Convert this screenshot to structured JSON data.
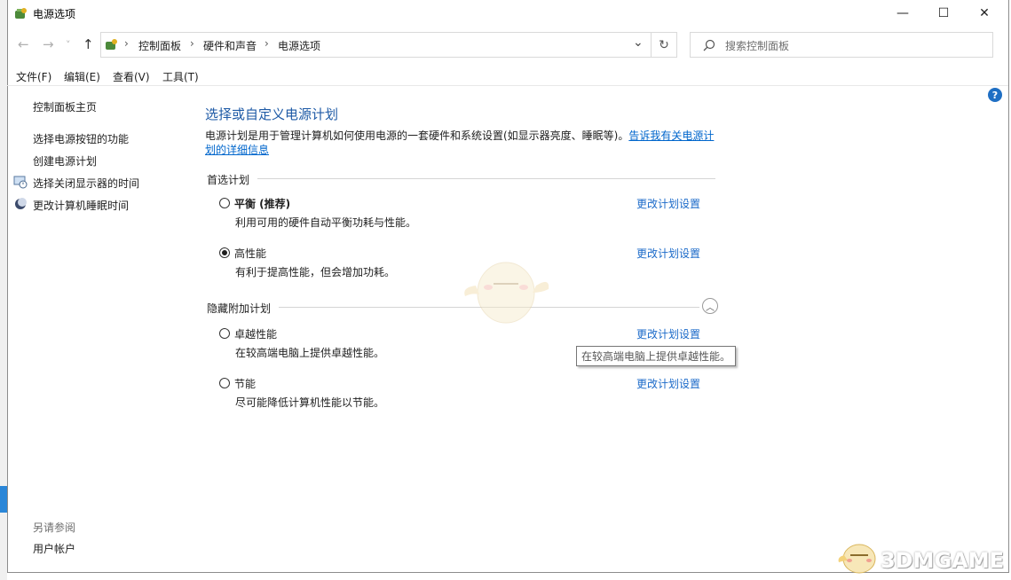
{
  "window": {
    "title": "电源选项",
    "minimize_icon": "—",
    "maximize_icon": "☐",
    "close_icon": "✕"
  },
  "nav": {
    "back_icon": "←",
    "forward_icon": "→",
    "recent_icon": "˅",
    "up_icon": "↑",
    "breadcrumb": [
      "控制面板",
      "硬件和声音",
      "电源选项"
    ],
    "dropdown_icon": "⌄",
    "refresh_icon": "↻"
  },
  "search": {
    "placeholder": "搜索控制面板"
  },
  "menu": [
    "文件(F)",
    "编辑(E)",
    "查看(V)",
    "工具(T)"
  ],
  "sidebar": {
    "home": "控制面板主页",
    "links": [
      "选择电源按钮的功能",
      "创建电源计划",
      "选择关闭显示器的时间",
      "更改计算机睡眠时间"
    ],
    "see_also_title": "另请参阅",
    "see_also_links": [
      "用户帐户"
    ]
  },
  "main": {
    "title": "选择或自定义电源计划",
    "description": "电源计划是用于管理计算机如何使用电源的一套硬件和系统设置(如显示器亮度、睡眠等)。",
    "description_link_1": "告诉我有关电源计",
    "description_link_2": "划的详细信息",
    "preferred_group": "首选计划",
    "hidden_group": "隐藏附加计划",
    "change_link": "更改计划设置",
    "plans": [
      {
        "name": "平衡 (推荐)",
        "desc": "利用可用的硬件自动平衡功耗与性能。",
        "selected": false
      },
      {
        "name": "高性能",
        "desc": "有利于提高性能，但会增加功耗。",
        "selected": true
      },
      {
        "name": "卓越性能",
        "desc": "在较高端电脑上提供卓越性能。",
        "selected": false
      },
      {
        "name": "节能",
        "desc": "尽可能降低计算机性能以节能。",
        "selected": false
      }
    ],
    "tooltip": "在较高端电脑上提供卓越性能。"
  },
  "help_icon": "?",
  "watermark": "3DMGAME"
}
